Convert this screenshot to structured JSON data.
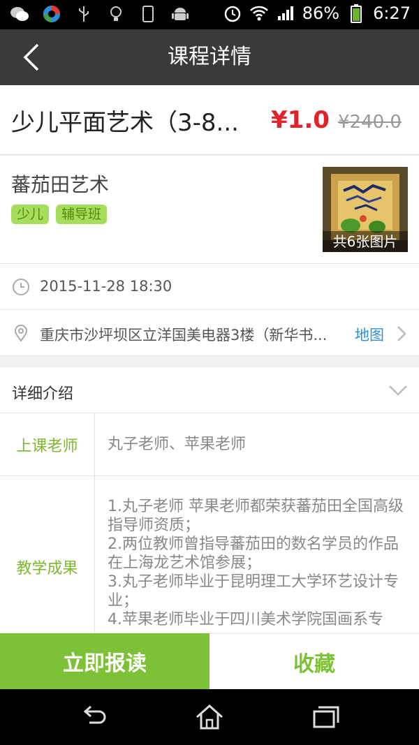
{
  "status_bar": {
    "battery": "86%",
    "time": "6:27",
    "icons": [
      "wechat-icon",
      "browser-icon",
      "usb-icon",
      "bulb-icon",
      "phone-icon",
      "android-icon",
      "alarm-icon",
      "wifi-icon",
      "signal-icon",
      "battery-icon"
    ]
  },
  "header": {
    "title": "课程详情",
    "back_icon": "chevron-left-icon"
  },
  "course": {
    "name": "少儿平面艺术（3-8...",
    "price": "¥1.0",
    "original_price": "¥240.0"
  },
  "organization": {
    "name": "蕃茄田艺术",
    "tags": [
      "少儿",
      "辅导班"
    ],
    "photo_caption": "共6张图片"
  },
  "schedule": {
    "datetime": "2015-11-28 18:30"
  },
  "location": {
    "address": "重庆市沙坪坝区立洋国美电器3楼（新华书...",
    "map_label": "地图"
  },
  "details": {
    "section_title": "详细介绍",
    "rows": [
      {
        "label": "上课老师",
        "value": "丸子老师、苹果老师"
      },
      {
        "label": "教学成果",
        "lines": [
          "1.丸子老师 苹果老师都荣获蕃茄田全国高级",
          "指导师资质；",
          "2.两位教师曾指导蕃茄田的数名学员的作品",
          "在上海龙艺术馆参展；",
          "3.丸子老师毕业于昆明理工大学环艺设计专",
          "业；",
          "4.苹果老师毕业于四川美术学院国画系专"
        ]
      }
    ]
  },
  "actions": {
    "enroll": "立即报读",
    "favorite": "收藏"
  },
  "colors": {
    "accent_green": "#7cc136",
    "price_red": "#e5212a",
    "link_blue": "#2d8fd5"
  }
}
